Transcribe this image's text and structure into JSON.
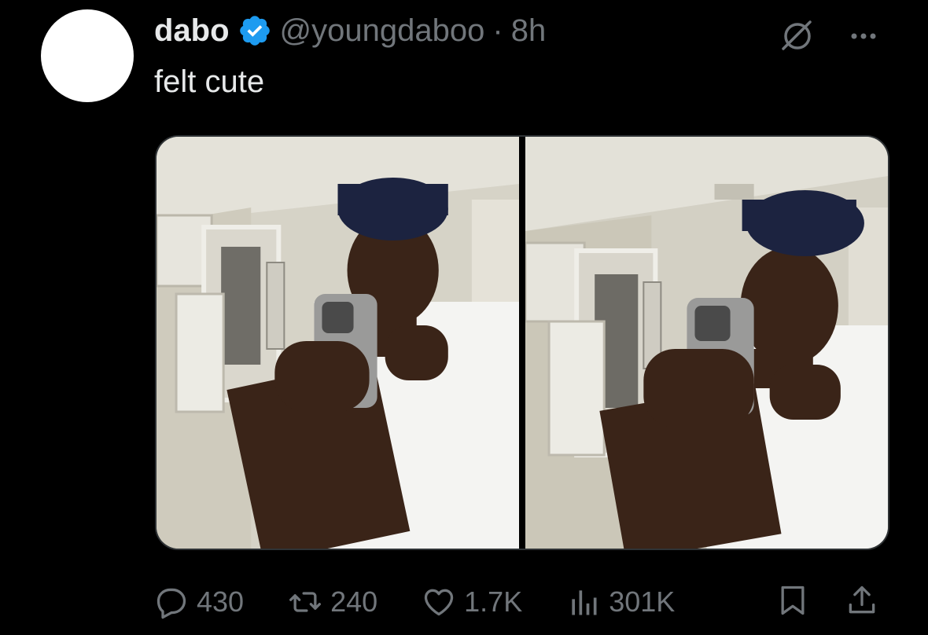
{
  "tweet": {
    "author_name": "dabo",
    "handle": "@youngdaboo",
    "separator": "·",
    "time": "8h",
    "text": "felt cute"
  },
  "actions": {
    "replies": "430",
    "reposts": "240",
    "likes": "1.7K",
    "views": "301K"
  },
  "colors": {
    "background": "#000000",
    "text": "#e7e9ea",
    "secondary": "#71767b",
    "verified": "#1d9bf0"
  },
  "icons": {
    "verified": "verified-badge-icon",
    "grok": "grok-icon",
    "more": "more-icon",
    "reply": "reply-icon",
    "repost": "repost-icon",
    "like": "heart-icon",
    "views": "views-icon",
    "bookmark": "bookmark-icon",
    "share": "share-icon"
  }
}
